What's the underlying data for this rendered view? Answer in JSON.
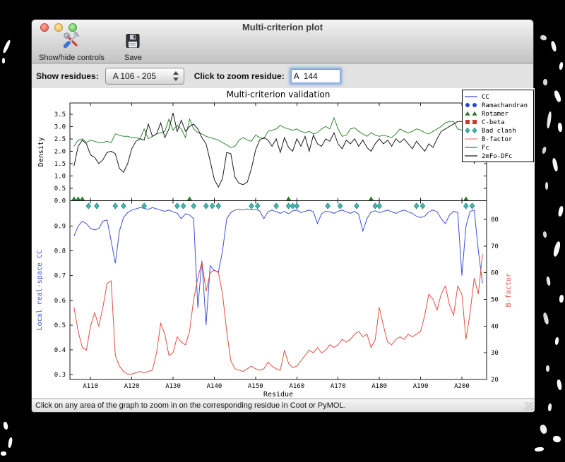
{
  "window": {
    "title": "Multi-criterion plot",
    "toolbar": {
      "show_hide_controls_label": "Show/hide controls",
      "save_label": "Save"
    },
    "controls": {
      "show_residues_label": "Show residues:",
      "residue_range_value": "A 106 - 205",
      "zoom_residue_label": "Click to zoom residue:",
      "zoom_residue_value": "A  144"
    },
    "status_bar_text": "Click on any area of the graph to zoom in on the corresponding residue in Coot or PyMOL."
  },
  "chart_data": {
    "type": "line",
    "title": "Multi-criterion validation",
    "xlabel": "Residue",
    "x_start": 106,
    "x_end": 205,
    "xlim": [
      105,
      206
    ],
    "x_ticks": [
      "A110",
      "A120",
      "A130",
      "A140",
      "A150",
      "A160",
      "A170",
      "A180",
      "A190",
      "A200"
    ],
    "x_tick_values": [
      110,
      120,
      130,
      140,
      150,
      160,
      170,
      180,
      190,
      200
    ],
    "panels": {
      "density": {
        "ylabel": "Density",
        "ylim": [
          0,
          3.95
        ],
        "yticks": [
          0.0,
          0.5,
          1.0,
          1.5,
          2.0,
          2.5,
          3.0,
          3.5
        ],
        "grid": false,
        "series": [
          {
            "name": "Fc",
            "color": "#338833",
            "values": [
              2.2,
              2.45,
              2.5,
              2.35,
              2.45,
              2.4,
              2.35,
              2.35,
              2.4,
              2.35,
              2.7,
              2.65,
              2.6,
              2.6,
              2.55,
              2.55,
              2.5,
              2.9,
              2.5,
              2.6,
              2.7,
              2.75,
              2.8,
              3.3,
              2.85,
              3.05,
              2.9,
              2.55,
              3.3,
              2.9,
              2.75,
              2.7,
              2.6,
              2.55,
              2.5,
              2.45,
              2.35,
              2.25,
              2.15,
              2.2,
              2.45,
              2.55,
              2.45,
              2.4,
              2.65,
              2.55,
              2.5,
              2.8,
              2.85,
              2.9,
              3.05,
              2.95,
              2.9,
              2.85,
              2.9,
              2.8,
              2.75,
              2.8,
              2.7,
              2.75,
              2.9,
              3.0,
              2.9,
              3.35,
              2.9,
              2.6,
              2.65,
              2.9,
              2.95,
              2.8,
              2.7,
              2.6,
              2.75,
              2.65,
              2.6,
              2.65,
              2.6,
              2.55,
              2.7,
              2.9,
              2.8,
              2.75,
              2.8,
              2.9,
              2.85,
              2.75,
              2.7,
              2.8,
              2.9,
              3.0,
              3.15,
              3.2,
              3.2,
              2.9,
              2.85,
              2.9,
              2.7,
              2.45,
              2.6,
              2.8
            ]
          },
          {
            "name": "2mFo-DFc",
            "color": "#1b1b1b",
            "values": [
              1.4,
              2.2,
              2.45,
              2.3,
              1.85,
              1.75,
              1.5,
              1.65,
              1.95,
              2.0,
              1.9,
              1.3,
              1.15,
              1.5,
              2.1,
              2.4,
              2.5,
              2.45,
              3.1,
              2.6,
              2.7,
              3.15,
              2.55,
              2.9,
              3.55,
              2.8,
              3.25,
              2.8,
              3.0,
              3.1,
              2.9,
              2.55,
              2.3,
              1.6,
              0.85,
              0.55,
              0.9,
              1.95,
              1.9,
              0.95,
              0.7,
              0.65,
              0.75,
              1.3,
              2.05,
              2.45,
              2.55,
              2.45,
              2.2,
              2.5,
              1.95,
              2.55,
              2.15,
              2.0,
              2.5,
              2.2,
              2.6,
              2.0,
              2.65,
              2.3,
              2.2,
              2.5,
              2.4,
              2.75,
              2.3,
              2.1,
              2.45,
              2.3,
              2.5,
              2.2,
              2.45,
              2.15,
              2.0,
              2.3,
              2.5,
              2.3,
              2.45,
              2.2,
              2.5,
              2.35,
              2.5,
              2.3,
              2.1,
              2.4,
              2.2,
              2.0,
              2.3,
              2.15,
              2.5,
              2.8,
              2.9,
              3.0,
              3.1,
              3.2,
              3.2,
              2.9,
              2.7,
              1.5,
              2.3,
              2.75
            ]
          }
        ]
      },
      "validation": {
        "left_axis": {
          "label": "Local real-space CC",
          "color": "#3f4fd8",
          "ylim": [
            0.28,
            1.003
          ],
          "yticks": [
            0.3,
            0.4,
            0.5,
            0.6,
            0.7,
            0.8,
            0.9
          ]
        },
        "right_axis": {
          "label": "B-factor",
          "color": "#e14f43",
          "ylim": [
            20,
            87
          ],
          "yticks": [
            20,
            30,
            40,
            50,
            60,
            70,
            80
          ]
        },
        "series": [
          {
            "name": "CC",
            "axis": "left",
            "color": "#3f4fd8",
            "values": [
              0.86,
              0.9,
              0.92,
              0.91,
              0.89,
              0.885,
              0.89,
              0.92,
              0.925,
              0.84,
              0.75,
              0.88,
              0.935,
              0.955,
              0.965,
              0.97,
              0.975,
              0.972,
              0.968,
              0.975,
              0.97,
              0.965,
              0.96,
              0.965,
              0.958,
              0.952,
              0.93,
              0.95,
              0.945,
              0.93,
              0.57,
              0.76,
              0.5,
              0.74,
              0.72,
              0.715,
              0.8,
              0.93,
              0.955,
              0.965,
              0.968,
              0.965,
              0.97,
              0.965,
              0.968,
              0.962,
              0.93,
              0.958,
              0.965,
              0.958,
              0.952,
              0.96,
              0.95,
              0.962,
              0.965,
              0.955,
              0.96,
              0.965,
              0.958,
              0.91,
              0.95,
              0.96,
              0.958,
              0.952,
              0.96,
              0.965,
              0.958,
              0.952,
              0.96,
              0.948,
              0.88,
              0.93,
              0.958,
              0.962,
              0.955,
              0.96,
              0.965,
              0.958,
              0.952,
              0.96,
              0.965,
              0.958,
              0.952,
              0.94,
              0.935,
              0.94,
              0.958,
              0.965,
              0.958,
              0.93,
              0.91,
              0.945,
              0.96,
              0.955,
              0.7,
              0.9,
              0.96,
              0.965,
              0.8,
              0.67
            ]
          },
          {
            "name": "B-factor",
            "axis": "right",
            "color": "#e14f43",
            "values": [
              47,
              38,
              32,
              31,
              40,
              45,
              40,
              47,
              56,
              57,
              29,
              25,
              23,
              22,
              22,
              22.5,
              23,
              22.5,
              23,
              23.5,
              30,
              41,
              37,
              29,
              30,
              36,
              34,
              33,
              38,
              50,
              58,
              64,
              53,
              60,
              61,
              60,
              52,
              38,
              27,
              24,
              23.5,
              23,
              24,
              25,
              24,
              23.5,
              24,
              26.5,
              25,
              24,
              23.5,
              31,
              26,
              24.5,
              25,
              27,
              29,
              31,
              30,
              32,
              30,
              31,
              33,
              32,
              33,
              35,
              34,
              35,
              37,
              38,
              36,
              37,
              32,
              35,
              47,
              40,
              34,
              33,
              35,
              36,
              35,
              37,
              36,
              37,
              38,
              44,
              52,
              50,
              46,
              52,
              55,
              48,
              44,
              55,
              52,
              35,
              45,
              58,
              52,
              67
            ]
          }
        ],
        "markers": {
          "rotamer": {
            "shape": "triangle",
            "color": "#2d7a2d",
            "residues": [
              106,
              107,
              108,
              134,
              158,
              178,
              201
            ]
          },
          "bad_clash": {
            "shape": "diamond",
            "color": "#45b8b0",
            "edge_color": "#23857e",
            "residues": [
              109.5,
              111.5,
              116,
              118,
              123,
              131,
              132.5,
              135,
              138,
              139.5,
              141,
              149,
              150.5,
              155,
              158,
              159,
              160,
              167.5,
              170.5,
              174.5,
              179,
              180,
              189,
              190.5,
              201,
              202.5
            ]
          }
        }
      }
    },
    "legend": {
      "position": "upper right",
      "items": [
        {
          "label": "CC",
          "kind": "line",
          "color": "#3f4fd8"
        },
        {
          "label": "Ramachandran",
          "kind": "markers",
          "shape": "circle",
          "color": "#2746d9"
        },
        {
          "label": "Rotamer",
          "kind": "markers",
          "shape": "triangle",
          "color": "#2d7a2d"
        },
        {
          "label": "C-beta",
          "kind": "markers",
          "shape": "square",
          "color": "#d9362b"
        },
        {
          "label": "Bad clash",
          "kind": "markers",
          "shape": "diamond",
          "color": "#45b8b0"
        },
        {
          "label": "B-factor",
          "kind": "line",
          "color": "#f0837a"
        },
        {
          "label": "Fc",
          "kind": "line",
          "color": "#338833"
        },
        {
          "label": "2mFo-DFc",
          "kind": "line",
          "color": "#1b1b1b"
        }
      ]
    }
  }
}
